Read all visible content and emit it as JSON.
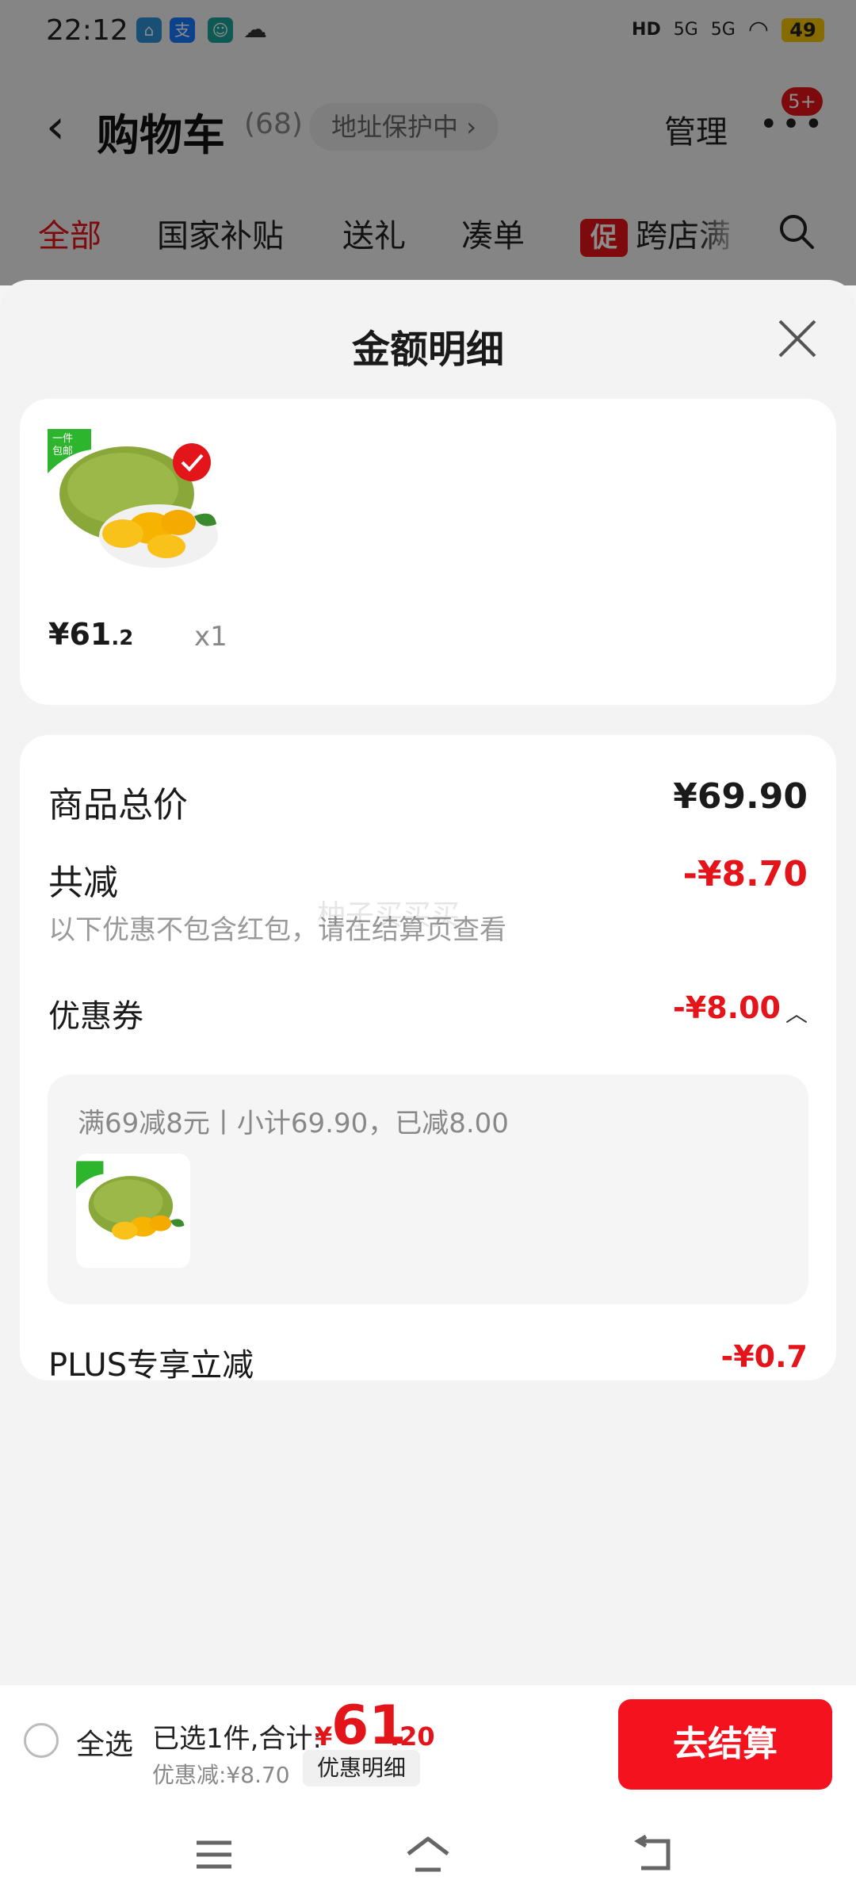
{
  "status_bar": {
    "time": "22:12",
    "network_1": "5G",
    "network_2": "5G",
    "hd": "HD",
    "battery": "49"
  },
  "cart": {
    "title": "购物车",
    "count": "(68)",
    "address_protect": "地址保护中",
    "manage": "管理",
    "badge": "5+",
    "tabs": [
      "全部",
      "国家补贴",
      "送礼",
      "凑单",
      "跨店满"
    ],
    "promo_tag": "促"
  },
  "sheet": {
    "title": "金额明细",
    "product": {
      "price_int": "¥61",
      "price_dec": ".2",
      "qty": "x1",
      "free_ship_tag": "一件包邮"
    },
    "summary": {
      "total_label": "商品总价",
      "total_value": "¥69.90",
      "reduce_label": "共减",
      "reduce_value": "-¥8.70",
      "reduce_note": "以下优惠不包含红包，请在结算页查看",
      "coupon_label": "优惠券",
      "coupon_value": "-¥8.00",
      "coupon_detail": "满69减8元丨小计69.90，已减8.00",
      "plus_label": "PLUS专享立减",
      "plus_value": "-¥0.7"
    },
    "watermark": "柚子买买买"
  },
  "bottom_bar": {
    "select_all": "全选",
    "selected": "已选1件,合计:",
    "total_yen": "¥",
    "total_int": "61",
    "total_dec": ".20",
    "discount": "优惠减:¥8.70",
    "detail_button": "优惠明细",
    "checkout": "去结算"
  },
  "colors": {
    "accent": "#e4141b",
    "checkout": "#f5121f",
    "sheet_bg": "#f3f3f3"
  }
}
